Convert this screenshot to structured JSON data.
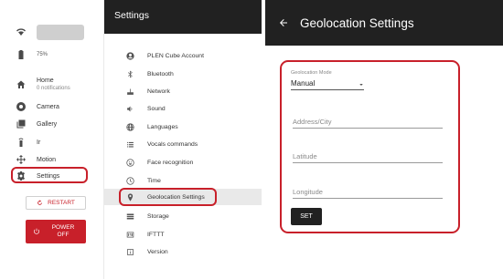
{
  "rail": {
    "battery_text": "75%",
    "items": [
      {
        "label": "Home",
        "sub": "0 notifications"
      },
      {
        "label": "Camera"
      },
      {
        "label": "Gallery"
      },
      {
        "label": "Ir"
      },
      {
        "label": "Motion"
      },
      {
        "label": "Settings"
      }
    ],
    "restart_label": "RESTART",
    "power_line1": "POWER",
    "power_line2": "OFF"
  },
  "menu": {
    "title": "Settings",
    "items": [
      {
        "label": "PLEN Cube Account"
      },
      {
        "label": "Bluetooth"
      },
      {
        "label": "Network"
      },
      {
        "label": "Sound"
      },
      {
        "label": "Languages"
      },
      {
        "label": "Vocals commands"
      },
      {
        "label": "Face recognition"
      },
      {
        "label": "Time"
      },
      {
        "label": "Geolocation Settings"
      },
      {
        "label": "Storage"
      },
      {
        "label": "IFTTT"
      },
      {
        "label": "Version"
      }
    ],
    "selected": "Geolocation Settings"
  },
  "panel": {
    "title": "Geolocation Settings",
    "mode_label": "Geolocation Mode",
    "mode_value": "Manual",
    "address_placeholder": "Address/City",
    "latitude_placeholder": "Latitude",
    "longitude_placeholder": "Longitude",
    "set_label": "SET"
  },
  "colors": {
    "accent_red": "#c8202a",
    "header_dark": "#212121"
  }
}
